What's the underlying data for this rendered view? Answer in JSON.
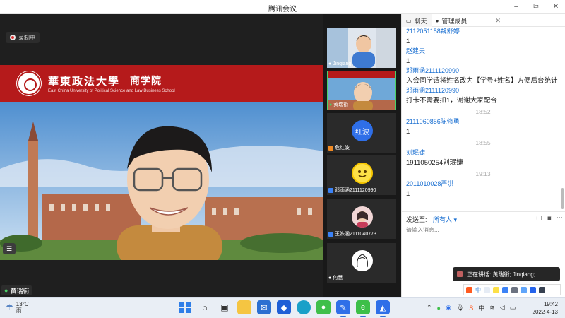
{
  "window": {
    "title": "腾讯会议",
    "minimize_glyph": "–",
    "maximize_glyph": "⧉",
    "close_glyph": "✕"
  },
  "recording": {
    "label": "录制中"
  },
  "main_video": {
    "speaker_name": "黄瑞衔",
    "banner_university_cn": "華東政法大學",
    "banner_school": "商学院",
    "banner_university_en": "East China University of Political Science and Law Business School"
  },
  "participants": [
    {
      "name": "Jinqiang",
      "kind": "video",
      "muted": false
    },
    {
      "name": "黄瑞衔",
      "kind": "video",
      "muted": false
    },
    {
      "name": "危红波",
      "kind": "avatar",
      "avatar_text": "红波",
      "avatar_color": "#2f6fe8"
    },
    {
      "name": "邓雨涵2111120990",
      "kind": "emoji"
    },
    {
      "name": "王姝涵2111040773",
      "kind": "photo"
    },
    {
      "name": "何慧",
      "kind": "sketch"
    }
  ],
  "panel": {
    "tabs": [
      {
        "label": "聊天",
        "icon": "chat-icon"
      },
      {
        "label": "管理成员",
        "icon": "users-icon"
      }
    ],
    "close_glyph": "✕"
  },
  "chat": [
    {
      "type": "name",
      "text": "2112051158魏舒婷"
    },
    {
      "type": "text",
      "text": "1"
    },
    {
      "type": "name",
      "text": "赵建夫"
    },
    {
      "type": "text",
      "text": "1"
    },
    {
      "type": "name",
      "text": "邓雨涵2111120990"
    },
    {
      "type": "text",
      "text": "入会同学请将姓名改为【学号+姓名】方便后台统计"
    },
    {
      "type": "name",
      "text": "邓雨涵2111120990"
    },
    {
      "type": "text",
      "text": "打卡不需要扣1，谢谢大家配合"
    },
    {
      "type": "time",
      "text": "18:52"
    },
    {
      "type": "name",
      "text": "2111060856陈修勇"
    },
    {
      "type": "text",
      "text": "1"
    },
    {
      "type": "time",
      "text": "18:55"
    },
    {
      "type": "name",
      "text": "刘珉婕"
    },
    {
      "type": "text",
      "text": "1911050254刘珉婕"
    },
    {
      "type": "time",
      "text": "19:13"
    },
    {
      "type": "name",
      "text": "2011010028严洪"
    },
    {
      "type": "text",
      "text": "1"
    }
  ],
  "send": {
    "label": "发送至:",
    "target": "所有人 ▾"
  },
  "input": {
    "placeholder": "请输入消息..."
  },
  "speaking": {
    "label": "正在讲话: 黄瑞衔; Jinqiang;"
  },
  "ime": {
    "lang": "中"
  },
  "taskbar": {
    "weather_temp": "13°C",
    "weather_cond": "雨",
    "time": "19:42",
    "date": "2022-4-13"
  }
}
